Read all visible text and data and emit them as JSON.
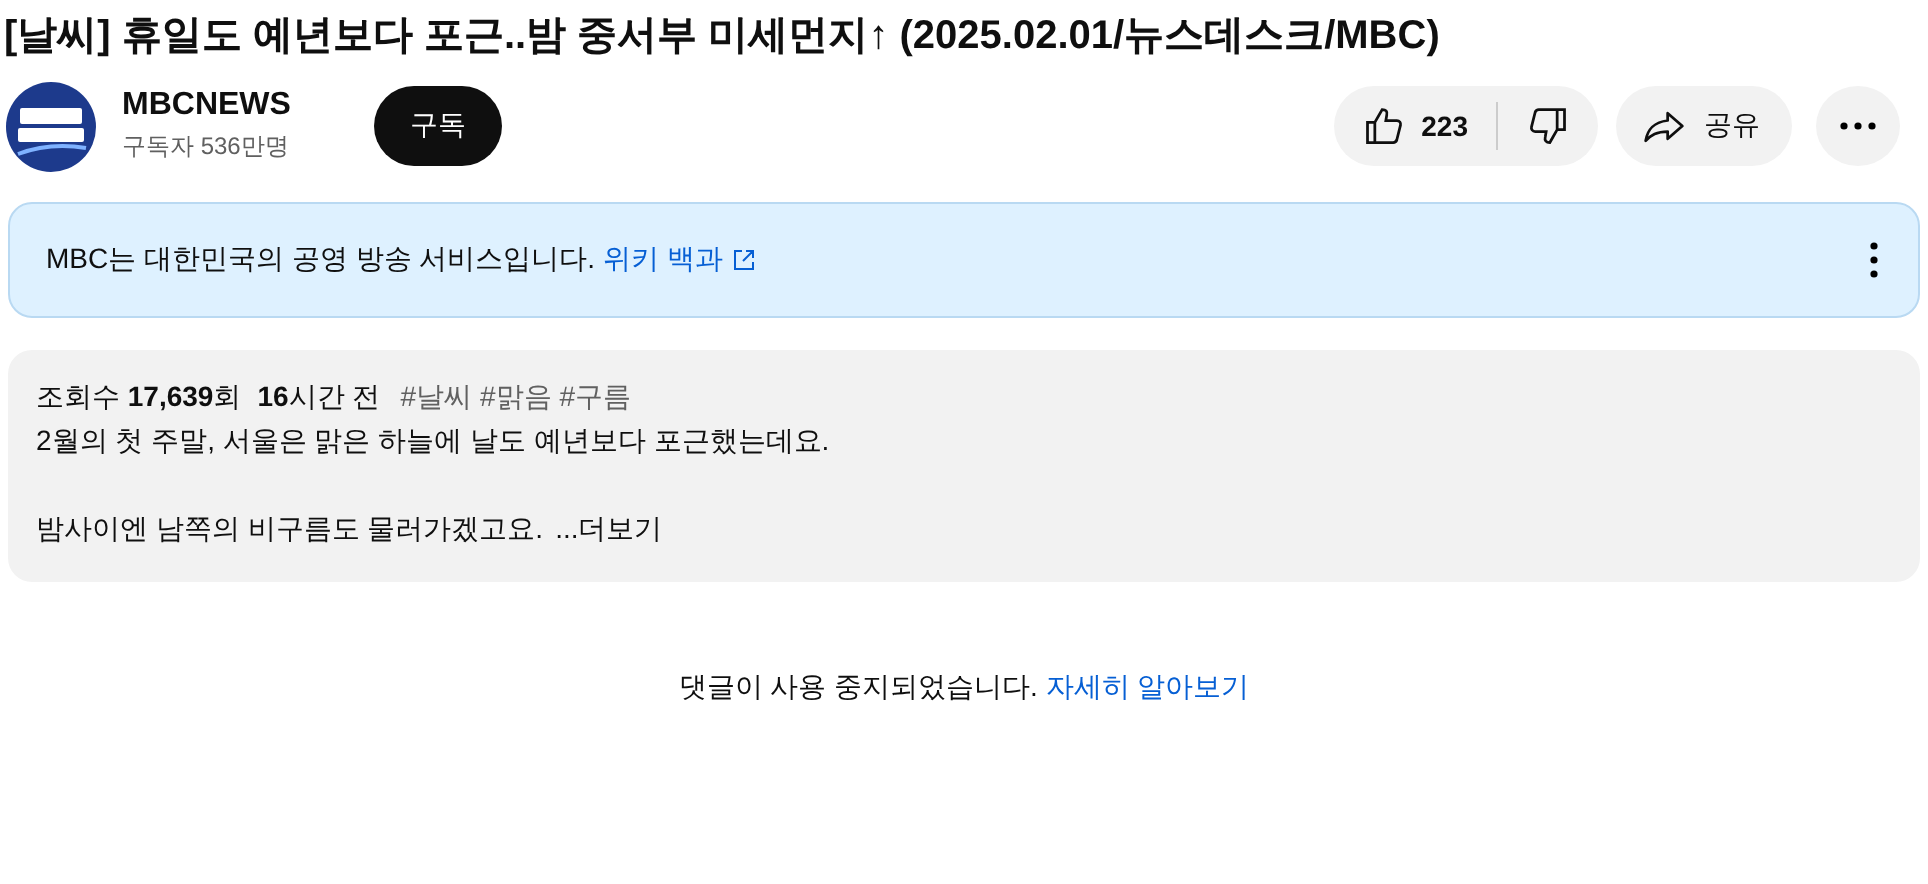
{
  "video": {
    "title": "[날씨] 휴일도 예년보다 포근..밤 중서부 미세먼지↑ (2025.02.01/뉴스데스크/MBC)"
  },
  "channel": {
    "name": "MBCNEWS",
    "subscribers": "구독자 536만명",
    "subscribe_label": "구독"
  },
  "actions": {
    "likes": "223",
    "share": "공유"
  },
  "info_panel": {
    "text": "MBC는 대한민국의 공영 방송 서비스입니다.",
    "link": "위키 백과"
  },
  "description": {
    "views": "조회수 **17,639**회",
    "age": "**16**시간 전",
    "tags": [
      "#날씨",
      "#맑음",
      "#구름"
    ],
    "lines": [
      "2월의 첫 주말, 서울은 맑은 하늘에 날도 예년보다 포근했는데요.",
      "밤사이엔 남쪽의 비구름도 물러가겠고요."
    ],
    "more": "...더보기"
  },
  "comments": {
    "notice": "댓글이 사용 중지되었습니다.",
    "link": "자세히 알아보기"
  }
}
